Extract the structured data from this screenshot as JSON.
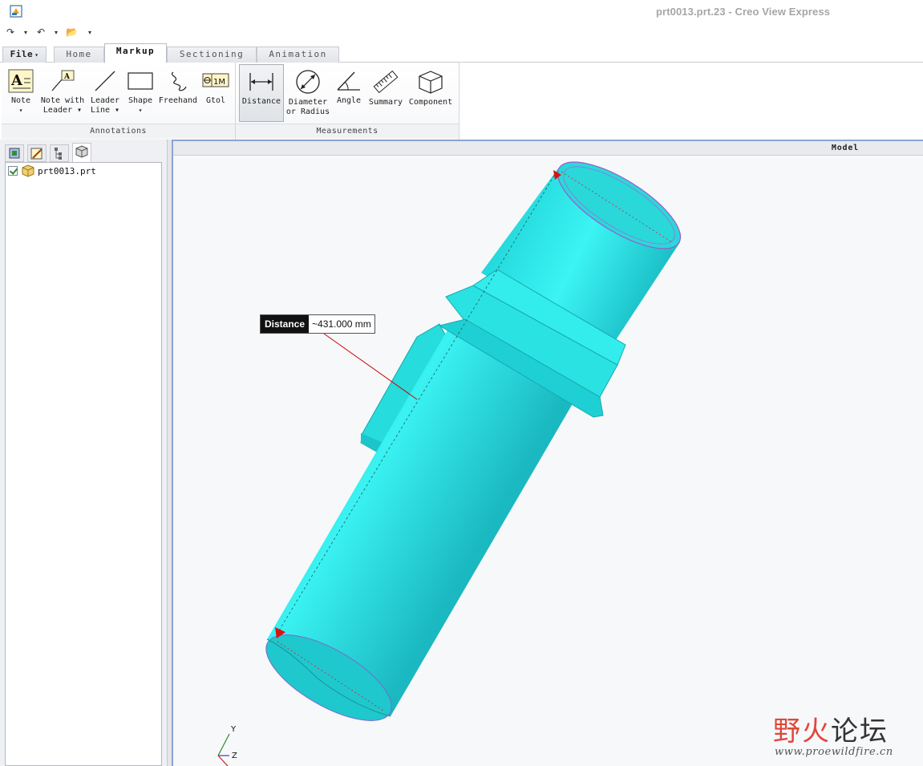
{
  "window": {
    "title": "prt0013.prt.23 - Creo View Express"
  },
  "quick_access": {
    "redo": "↷",
    "undo": "↶",
    "open": "📂",
    "more": "▾"
  },
  "tabs": [
    {
      "label": "File",
      "arrow": "▾"
    },
    {
      "label": "Home"
    },
    {
      "label": "Markup"
    },
    {
      "label": "Sectioning"
    },
    {
      "label": "Animation"
    }
  ],
  "ribbon": {
    "groups": [
      {
        "label": "Annotations"
      },
      {
        "label": "Measurements"
      }
    ],
    "buttons": [
      {
        "line1": "Note",
        "line2": "▾"
      },
      {
        "line1": "Note with",
        "line2": "Leader ▾"
      },
      {
        "line1": "Leader",
        "line2": "Line ▾"
      },
      {
        "line1": "Shape",
        "line2": "▾"
      },
      {
        "line1": "Freehand",
        "line2": ""
      },
      {
        "line1": "Gtol",
        "line2": ""
      },
      {
        "line1": "Distance",
        "line2": ""
      },
      {
        "line1": "Diameter",
        "line2": "or Radius"
      },
      {
        "line1": "Angle",
        "line2": ""
      },
      {
        "line1": "Summary",
        "line2": ""
      },
      {
        "line1": "Component",
        "line2": ""
      }
    ],
    "gtol_text": "1M",
    "note_text": "A"
  },
  "tree": {
    "items": [
      {
        "label": "prt0013.prt",
        "checked": true
      }
    ]
  },
  "viewport": {
    "title": "Model",
    "measurement": {
      "name": "Distance",
      "value": "~431.000 mm"
    },
    "triad": {
      "y": "Y",
      "z": "Z"
    }
  },
  "watermark": {
    "cn_red": "野火",
    "cn_dark": "论坛",
    "url": "www.proewildfire.cn"
  },
  "colors": {
    "model": "#22e4e4",
    "accent": "#8da4d4",
    "leader": "#cc0000"
  }
}
